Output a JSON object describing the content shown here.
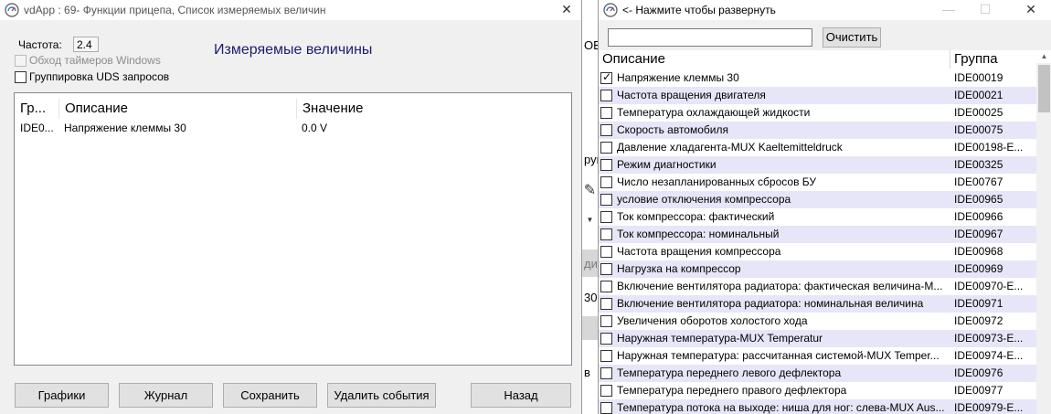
{
  "left_window": {
    "title": "vdApp : 69- Функции прицепа,  Список измеряемых величин",
    "frequency_label": "Частота:",
    "frequency_value": "2.4",
    "bypass_timers_label": "Обход таймеров Windows",
    "group_uds_label": "Группировка UDS запросов",
    "heading": "Измеряемые величины",
    "list": {
      "columns": [
        "Гр...",
        "Описание",
        "Значение"
      ],
      "rows": [
        {
          "group": "IDE0...",
          "description": "Напряжение клеммы 30",
          "value": "0.0 V"
        }
      ]
    },
    "buttons": {
      "graphs": "Графики",
      "journal": "Журнал",
      "save": "Сохранить",
      "delete_events": "Удалить события",
      "back": "Назад"
    }
  },
  "backdrop": {
    "fragments": [
      "ОВ",
      "руи",
      "ди",
      "30"
    ]
  },
  "right_window": {
    "title": "<- Нажмите чтобы развернуть",
    "search": {
      "value": "",
      "placeholder": ""
    },
    "clear_button": "Очистить",
    "columns": {
      "description": "Описание",
      "group": "Группа"
    },
    "rows": [
      {
        "checked": true,
        "description": "Напряжение клеммы 30",
        "group": "IDE00019"
      },
      {
        "checked": false,
        "description": "Частота вращения двигателя",
        "group": "IDE00021"
      },
      {
        "checked": false,
        "description": "Температура охлаждающей жидкости",
        "group": "IDE00025"
      },
      {
        "checked": false,
        "description": "Скорость автомобиля",
        "group": "IDE00075"
      },
      {
        "checked": false,
        "description": "Давление хладагента-MUX Kaeltemitteldruck",
        "group": "IDE00198-E..."
      },
      {
        "checked": false,
        "description": "Режим диагностики",
        "group": "IDE00325"
      },
      {
        "checked": false,
        "description": "Число незапланированных сбросов БУ",
        "group": "IDE00767"
      },
      {
        "checked": false,
        "description": "условие отключения компрессора",
        "group": "IDE00965"
      },
      {
        "checked": false,
        "description": "Ток компрессора: фактический",
        "group": "IDE00966"
      },
      {
        "checked": false,
        "description": "Ток компрессора: номинальный",
        "group": "IDE00967"
      },
      {
        "checked": false,
        "description": "Частота вращения компрессора",
        "group": "IDE00968"
      },
      {
        "checked": false,
        "description": "Нагрузка на компрессор",
        "group": "IDE00969"
      },
      {
        "checked": false,
        "description": "Включение вентилятора радиатора: фактическая величина-M...",
        "group": "IDE00970-E..."
      },
      {
        "checked": false,
        "description": "Включение вентилятора радиатора: номинальная величина",
        "group": "IDE00971"
      },
      {
        "checked": false,
        "description": "Увеличения оборотов холостого хода",
        "group": "IDE00972"
      },
      {
        "checked": false,
        "description": "Наружная температура-MUX Temperatur",
        "group": "IDE00973-E..."
      },
      {
        "checked": false,
        "description": "Наружная температура: рассчитанная системой-MUX Temper...",
        "group": "IDE00974-E..."
      },
      {
        "checked": false,
        "description": "Температура переднего левого дефлектора",
        "group": "IDE00976"
      },
      {
        "checked": false,
        "description": "Температура переднего правого дефлектора",
        "group": "IDE00977"
      },
      {
        "checked": false,
        "description": "Температура потока на выходе: ниша для ног: слева-MUX Aus...",
        "group": "IDE00979-E..."
      }
    ]
  },
  "colors": {
    "heading": "#1c1c6e",
    "alt_row": "#e6e6f8",
    "window_bg": "#f0f0f0"
  }
}
